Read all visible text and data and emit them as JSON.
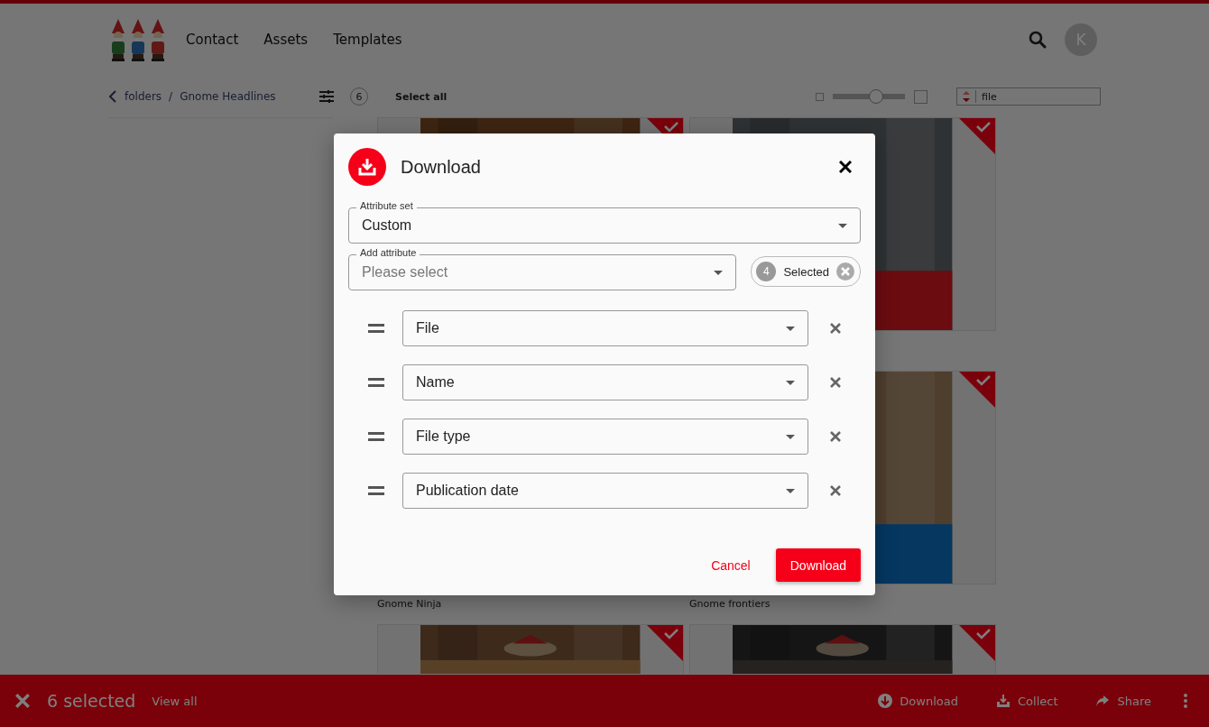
{
  "header": {
    "nav": [
      "Contact",
      "Assets",
      "Templates"
    ],
    "avatar": "K"
  },
  "breadcrumb": {
    "items": [
      "folders",
      "Gnome Headlines"
    ],
    "separator": "/"
  },
  "count": "6",
  "select_all": "Select all",
  "zoom_slider": {
    "level": 0.6
  },
  "sort_field": {
    "value": "file"
  },
  "assets": [
    {
      "kind": "picture",
      "selected": true
    },
    {
      "kind": "picture",
      "selected": true
    },
    {
      "caption": "Gnome Ninja"
    },
    {
      "kind": "picture",
      "caption": "Gnome frontiers",
      "selected": true
    },
    {
      "kind": "picture",
      "selected": true
    },
    {
      "kind": "picture",
      "selected": true
    }
  ],
  "dialog": {
    "title": "Download",
    "attribute_set": {
      "label": "Attribute set",
      "value": "Custom"
    },
    "add_attribute": {
      "label": "Add attribute",
      "placeholder": "Please select"
    },
    "chip": {
      "count": "4",
      "label": "Selected"
    },
    "attributes": [
      "File",
      "Name",
      "File type",
      "Publication date"
    ],
    "buttons": [
      {
        "label": "Cancel",
        "kind": "text"
      },
      {
        "label": "Download",
        "kind": "primary"
      }
    ]
  },
  "bottom_bar": {
    "count": "6 selected",
    "view_all": "View all",
    "actions": [
      "Download",
      "Collect",
      "Share"
    ]
  }
}
